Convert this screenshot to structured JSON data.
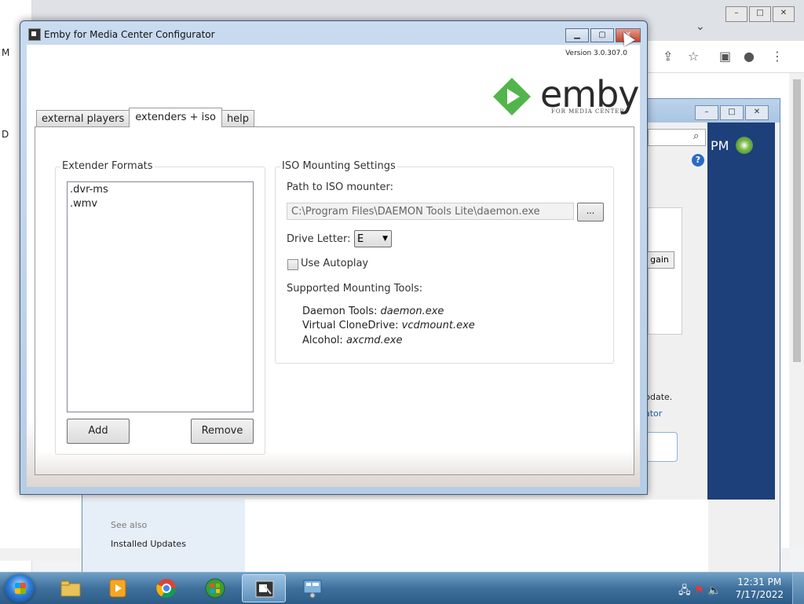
{
  "background_browser": {
    "window_controls": [
      "–",
      "□",
      "✕"
    ],
    "toolbar_icons": [
      "share-icon",
      "star-icon",
      "sidebar-icon",
      "profile-icon",
      "menu-icon"
    ],
    "left_edge_letters": [
      "M",
      "D"
    ]
  },
  "control_panel": {
    "time_fragment": "PM",
    "button_fragment": "gain",
    "update_fragment": "pdate.",
    "link_fragment": "ator",
    "see_also": "See also",
    "installed_updates": "Installed Updates"
  },
  "emby_window": {
    "title": "Emby for Media Center Configurator",
    "version": "Version 3.0.307.0",
    "logo_text": "emby",
    "logo_subtext": "FOR MEDIA CENTER",
    "colors": {
      "logo_green": "#52b54b",
      "title_gradient_top": "#c9dbef"
    },
    "tabs": [
      {
        "label": "external players",
        "active": false
      },
      {
        "label": "extenders + iso",
        "active": true
      },
      {
        "label": "help",
        "active": false
      }
    ],
    "extender_formats": {
      "heading": "Extender Formats",
      "items": [
        ".dvr-ms",
        ".wmv"
      ],
      "add_label": "Add",
      "remove_label": "Remove"
    },
    "iso_settings": {
      "heading": "ISO Mounting Settings",
      "path_label": "Path to ISO mounter:",
      "path_value": "C:\\Program Files\\DAEMON Tools Lite\\daemon.exe",
      "browse_label": "...",
      "drive_letter_label": "Drive Letter:",
      "drive_letter_value": "E",
      "autoplay_label": "Use Autoplay",
      "autoplay_checked": false,
      "supported_heading": "Supported Mounting Tools:",
      "tools": [
        {
          "name": "Daemon Tools:",
          "exe": "daemon.exe"
        },
        {
          "name": "Virtual CloneDrive:",
          "exe": "vcdmount.exe"
        },
        {
          "name": "Alcohol:",
          "exe": "axcmd.exe"
        }
      ]
    }
  },
  "taskbar": {
    "apps": [
      "windows-explorer-icon",
      "media-player-icon",
      "chrome-icon",
      "media-center-icon",
      "configurator-icon",
      "remote-desktop-icon"
    ],
    "time": "12:31 PM",
    "date": "7/17/2022"
  }
}
